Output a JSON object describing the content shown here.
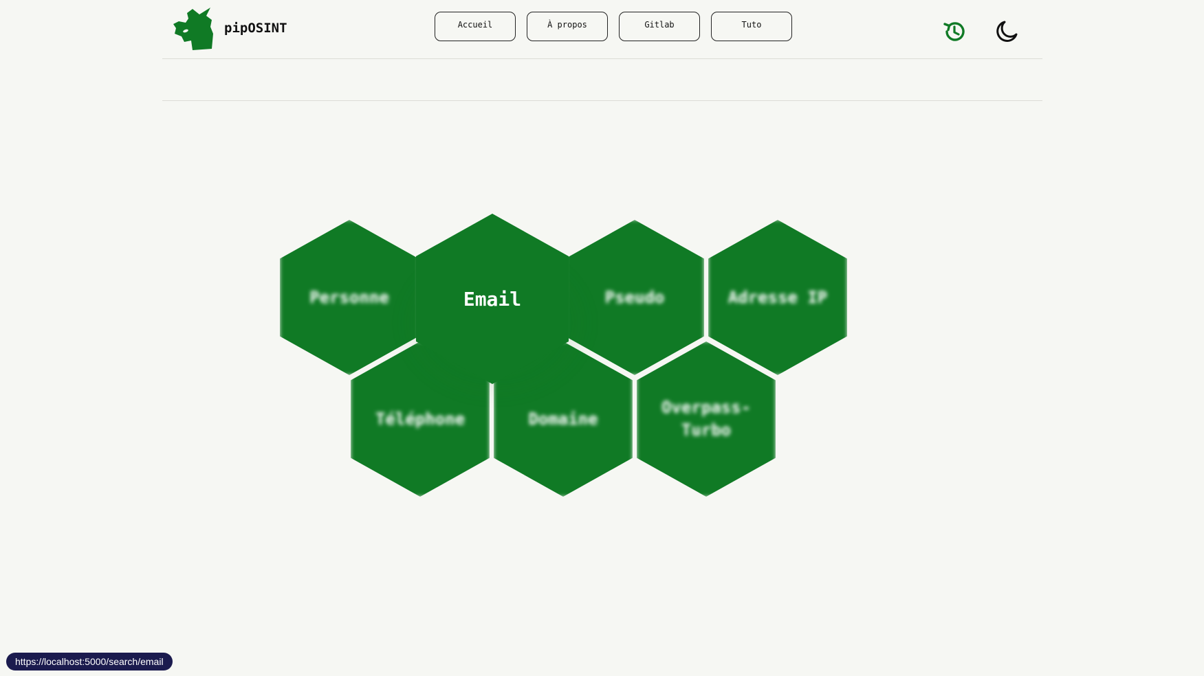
{
  "header": {
    "brand_name": "pipOSINT",
    "logo_icon": "green-figure-logo",
    "nav": [
      {
        "label": "Accueil"
      },
      {
        "label": "À propos"
      },
      {
        "label": "Gitlab"
      },
      {
        "label": "Tuto"
      }
    ],
    "icons": {
      "history": "history-icon",
      "theme": "moon-icon"
    }
  },
  "colors": {
    "accent": "#107a25",
    "background": "#f6f7f3",
    "status_bar": "#1b1b4e"
  },
  "categories": [
    {
      "label": "Personne"
    },
    {
      "label": "Email",
      "active": true
    },
    {
      "label": "Pseudo"
    },
    {
      "label": "Adresse IP"
    },
    {
      "label": "Téléphone"
    },
    {
      "label": "Domaine"
    },
    {
      "label": "Overpass-Turbo"
    }
  ],
  "status_bar": {
    "url": "https://localhost:5000/search/email"
  }
}
